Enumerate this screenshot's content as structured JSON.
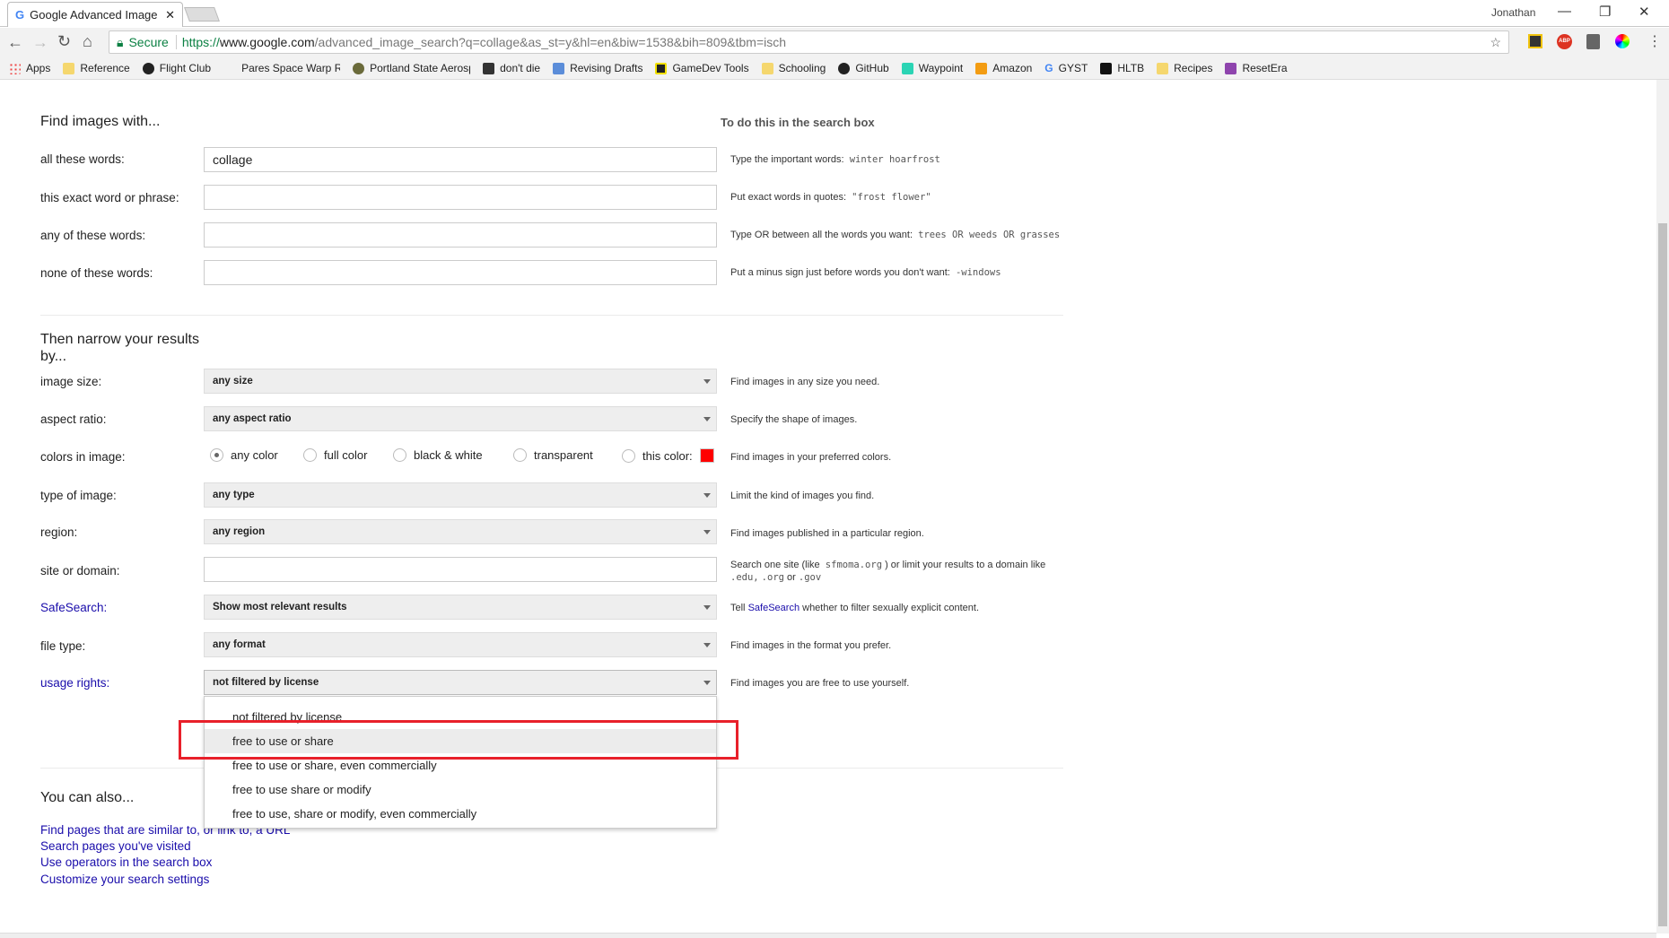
{
  "browser": {
    "tab_title": "Google Advanced Image",
    "user": "Jonathan",
    "secure_label": "Secure",
    "url_scheme": "https://",
    "url_host": "www.google.com",
    "url_path": "/advanced_image_search?q=collage&as_st=y&hl=en&biw=1538&bih=809&tbm=isch",
    "bookmarks": [
      {
        "label": "Apps",
        "color": "#e44"
      },
      {
        "label": "Reference",
        "color": "#f5d76e"
      },
      {
        "label": "Flight Club",
        "color": "#222"
      },
      {
        "label": "Pares Space Warp Re",
        "color": "#fff"
      },
      {
        "label": "Portland State Aerosp",
        "color": "#6a6a3a"
      },
      {
        "label": "don't die",
        "color": "#333"
      },
      {
        "label": "Revising Drafts",
        "color": "#5b8dd9"
      },
      {
        "label": "GameDev Tools",
        "color": "#222"
      },
      {
        "label": "Schooling",
        "color": "#f5d76e"
      },
      {
        "label": "GitHub",
        "color": "#222"
      },
      {
        "label": "Waypoint",
        "color": "#2bd4b4"
      },
      {
        "label": "Amazon",
        "color": "#f39c12"
      },
      {
        "label": "GYST",
        "color": "#4285f4"
      },
      {
        "label": "HLTB",
        "color": "#111"
      },
      {
        "label": "Recipes",
        "color": "#f5d76e"
      },
      {
        "label": "ResetEra",
        "color": "#8e44ad"
      }
    ]
  },
  "find": {
    "heading": "Find images with...",
    "side_heading": "To do this in the search box",
    "rows": [
      {
        "label": "all these words:",
        "value": "collage",
        "hint": "Type the important words:",
        "example": "winter hoarfrost"
      },
      {
        "label": "this exact word or phrase:",
        "value": "",
        "hint": "Put exact words in quotes:",
        "example": "\"frost flower\""
      },
      {
        "label": "any of these words:",
        "value": "",
        "hint": "Type OR between all the words you want:",
        "example": "trees OR weeds OR grasses"
      },
      {
        "label": "none of these words:",
        "value": "",
        "hint": "Put a minus sign just before words you don't want:",
        "example": "-windows"
      }
    ]
  },
  "narrow": {
    "heading": "Then narrow your results by...",
    "image_size": {
      "label": "image size:",
      "value": "any size",
      "hint": "Find images in any size you need."
    },
    "aspect_ratio": {
      "label": "aspect ratio:",
      "value": "any aspect ratio",
      "hint": "Specify the shape of images."
    },
    "colors": {
      "label": "colors in image:",
      "options": [
        "any color",
        "full color",
        "black & white",
        "transparent",
        "this color:"
      ],
      "selected": "any color",
      "swatch": "#ff0000",
      "hint": "Find images in your preferred colors."
    },
    "type": {
      "label": "type of image:",
      "value": "any type",
      "hint": "Limit the kind of images you find."
    },
    "region": {
      "label": "region:",
      "value": "any region",
      "hint": "Find images published in a particular region."
    },
    "site": {
      "label": "site or domain:",
      "value": "",
      "hint1": "Search one site (like",
      "ex1": "sfmoma.org",
      "hint2": ") or limit your results to a domain like",
      "ex2": ".edu,",
      "ex3": ".org",
      "hint3": "or",
      "ex4": ".gov"
    },
    "safesearch": {
      "label": "SafeSearch:",
      "value": "Show most relevant results",
      "hint_pre": "Tell",
      "hint_link": "SafeSearch",
      "hint_post": "whether to filter sexually explicit content."
    },
    "file_type": {
      "label": "file type:",
      "value": "any format",
      "hint": "Find images in the format you prefer."
    },
    "usage": {
      "label": "usage rights:",
      "value": "not filtered by license",
      "hint": "Find images you are free to use yourself.",
      "options": [
        "not filtered by license",
        "free to use or share",
        "free to use or share, even commercially",
        "free to use share or modify",
        "free to use, share or modify, even commercially"
      ],
      "highlighted": "free to use or share"
    }
  },
  "also": {
    "heading": "You can also...",
    "links": [
      "Find pages that are similar to, or link to, a URL",
      "Search pages you've visited",
      "Use operators in the search box",
      "Customize your search settings"
    ]
  },
  "colors": {
    "link": "#1a0dab",
    "annotation": "#e8202a"
  }
}
